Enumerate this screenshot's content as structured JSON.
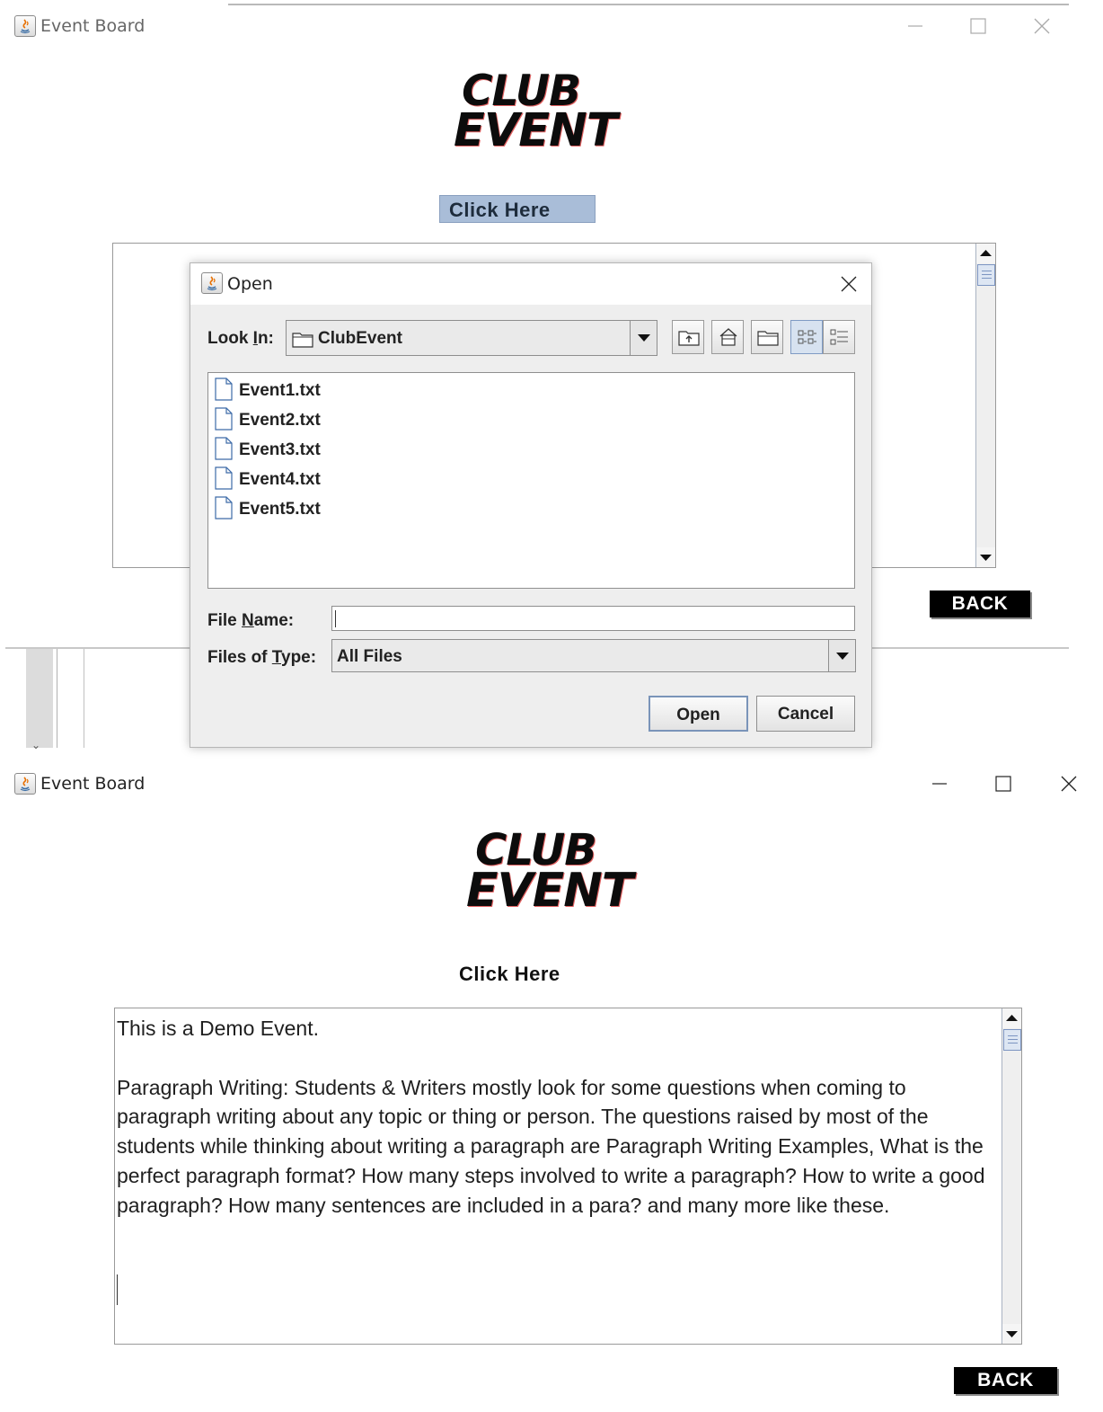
{
  "top_window": {
    "title": "Event Board",
    "logo_line1": "CLUB",
    "logo_line2": "EVENT",
    "click_button_label": "Click Here",
    "back_label": "BACK"
  },
  "open_dialog": {
    "title": "Open",
    "look_in_label_pre": "Look ",
    "look_in_label_mnemonic": "I",
    "look_in_label_post": "n:",
    "look_in_value": "ClubEvent",
    "files": [
      "Event1.txt",
      "Event2.txt",
      "Event3.txt",
      "Event4.txt",
      "Event5.txt"
    ],
    "file_name_label_pre": "File ",
    "file_name_label_mnemonic": "N",
    "file_name_label_post": "ame:",
    "file_name_value": "",
    "files_of_type_label_pre": "Files of ",
    "files_of_type_label_mnemonic": "T",
    "files_of_type_label_post": "ype:",
    "files_of_type_value": "All Files",
    "open_button": "Open",
    "cancel_button": "Cancel",
    "toolbar_icons": [
      "up-folder-icon",
      "home-icon",
      "new-folder-icon",
      "list-view-icon",
      "details-view-icon"
    ]
  },
  "bottom_window": {
    "title": "Event Board",
    "logo_line1": "CLUB",
    "logo_line2": "EVENT",
    "click_label": "Click Here",
    "content": "This is a Demo Event.\n\nParagraph Writing: Students & Writers mostly look for some questions when coming to paragraph writing about any topic or thing or person. The questions raised by most of the students while thinking about writing a paragraph are Paragraph Writing Examples, What is the perfect paragraph format? How many steps involved to write a paragraph? How to write a good paragraph? How many sentences are included in a para? and many more like these.",
    "back_label": "BACK"
  },
  "colors": {
    "click_button_bg": "#a9bdd8",
    "back_button_bg": "#000000",
    "scroll_thumb": "#dde6f3"
  }
}
